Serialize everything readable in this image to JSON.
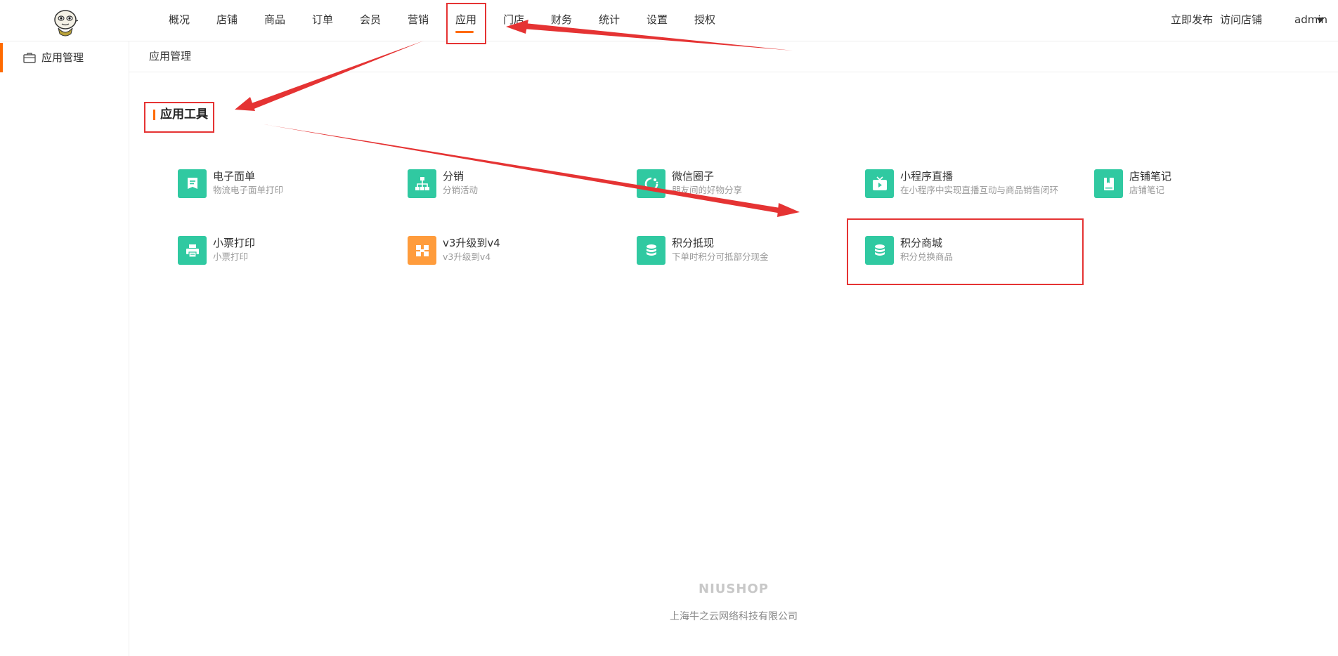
{
  "header": {
    "nav": [
      {
        "label": "概况"
      },
      {
        "label": "店铺"
      },
      {
        "label": "商品"
      },
      {
        "label": "订单"
      },
      {
        "label": "会员"
      },
      {
        "label": "营销"
      },
      {
        "label": "应用",
        "active": true
      },
      {
        "label": "门店"
      },
      {
        "label": "财务"
      },
      {
        "label": "统计"
      },
      {
        "label": "设置"
      },
      {
        "label": "授权"
      }
    ],
    "publish_label": "立即发布",
    "visit_label": "访问店铺",
    "user_label": "admin",
    "accent_color": "#ff6a00"
  },
  "sidebar": {
    "items": [
      {
        "label": "应用管理",
        "icon": "briefcase-icon",
        "active": true
      }
    ]
  },
  "breadcrumb": "应用管理",
  "section": {
    "title": "应用工具"
  },
  "apps": [
    {
      "title": "电子面单",
      "desc": "物流电子面单打印",
      "icon": "document-icon",
      "color": "#30c9a1"
    },
    {
      "title": "分销",
      "desc": "分销活动",
      "icon": "org-chart-icon",
      "color": "#30c9a1"
    },
    {
      "title": "微信圈子",
      "desc": "朋友间的好物分享",
      "icon": "refresh-circle-icon",
      "color": "#30c9a1"
    },
    {
      "title": "小程序直播",
      "desc": "在小程序中实现直播互动与商品销售闭环",
      "icon": "tv-icon",
      "color": "#30c9a1"
    },
    {
      "title": "店铺笔记",
      "desc": "店铺笔记",
      "icon": "book-icon",
      "color": "#30c9a1"
    },
    {
      "title": "小票打印",
      "desc": "小票打印",
      "icon": "printer-icon",
      "color": "#30c9a1"
    },
    {
      "title": "v3升级到v4",
      "desc": "v3升级到v4",
      "icon": "upgrade-icon",
      "color": "#ff9c3c"
    },
    {
      "title": "积分抵现",
      "desc": "下单时积分可抵部分现金",
      "icon": "coins-icon",
      "color": "#30c9a1"
    },
    {
      "title": "积分商城",
      "desc": "积分兑换商品",
      "icon": "coins-icon",
      "color": "#30c9a1"
    }
  ],
  "footer": {
    "brand": "NIUSHOP",
    "company": "上海牛之云网络科技有限公司"
  },
  "annotation_color": "#e53333"
}
